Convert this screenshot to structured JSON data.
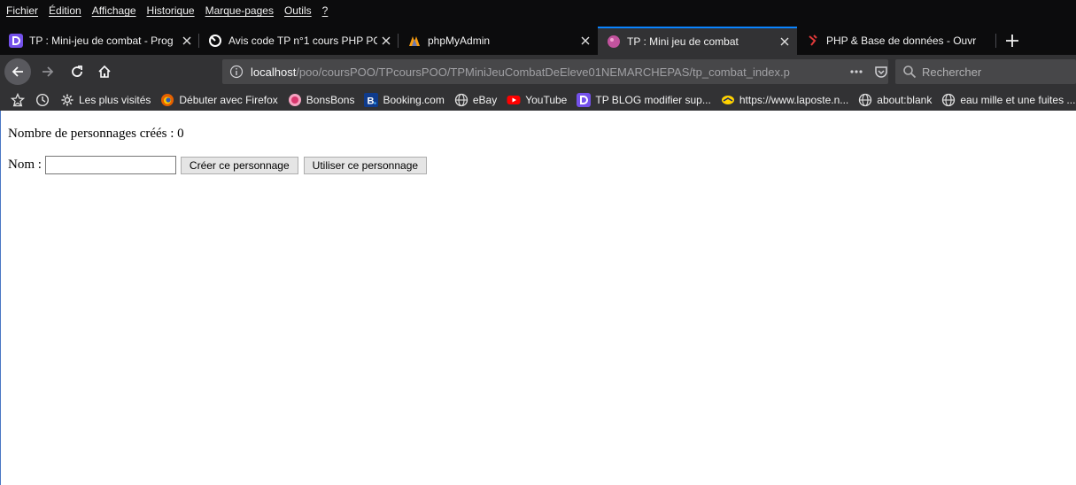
{
  "menubar": {
    "items": [
      "Fichier",
      "Édition",
      "Affichage",
      "Historique",
      "Marque-pages",
      "Outils",
      "?"
    ]
  },
  "tabs": [
    {
      "title": "TP : Mini-jeu de combat - Prog",
      "icon": "openclassrooms-icon",
      "active": false
    },
    {
      "title": "Avis code TP n°1 cours PHP POO",
      "icon": "forum-icon",
      "active": false
    },
    {
      "title": "phpMyAdmin",
      "icon": "phpmyadmin-icon",
      "active": false
    },
    {
      "title": "TP : Mini jeu de combat",
      "icon": "page-icon",
      "active": true
    },
    {
      "title": "PHP & Base de données - Ouvr",
      "icon": "php-icon",
      "active": false
    }
  ],
  "navbar": {
    "url_host": "localhost",
    "url_path": "/poo/coursPOO/TPcoursPOO/TPMiniJeuCombatDeEleve01NEMARCHEPAS/tp_combat_index.p",
    "search_placeholder": "Rechercher"
  },
  "bookmarks": [
    {
      "label": "Les plus visités",
      "icon": "gear-icon"
    },
    {
      "label": "Débuter avec Firefox",
      "icon": "firefox-icon"
    },
    {
      "label": "BonsBons",
      "icon": "bonsbons-icon"
    },
    {
      "label": "Booking.com",
      "icon": "booking-icon"
    },
    {
      "label": "eBay",
      "icon": "globe-icon"
    },
    {
      "label": "YouTube",
      "icon": "youtube-icon"
    },
    {
      "label": "TP BLOG modifier sup...",
      "icon": "openclassrooms-icon"
    },
    {
      "label": "https://www.laposte.n...",
      "icon": "laposte-icon"
    },
    {
      "label": "about:blank",
      "icon": "globe-icon"
    },
    {
      "label": "eau mille et une fuites ...",
      "icon": "globe-icon"
    }
  ],
  "page": {
    "count_text": "Nombre de personnages créés : 0",
    "name_label": "Nom :",
    "name_value": "",
    "create_button": "Créer ce personnage",
    "use_button": "Utiliser ce personnage"
  },
  "colors": {
    "chrome_dark": "#0c0c0d",
    "toolbar": "#323234",
    "accent": "#0a84ff"
  }
}
